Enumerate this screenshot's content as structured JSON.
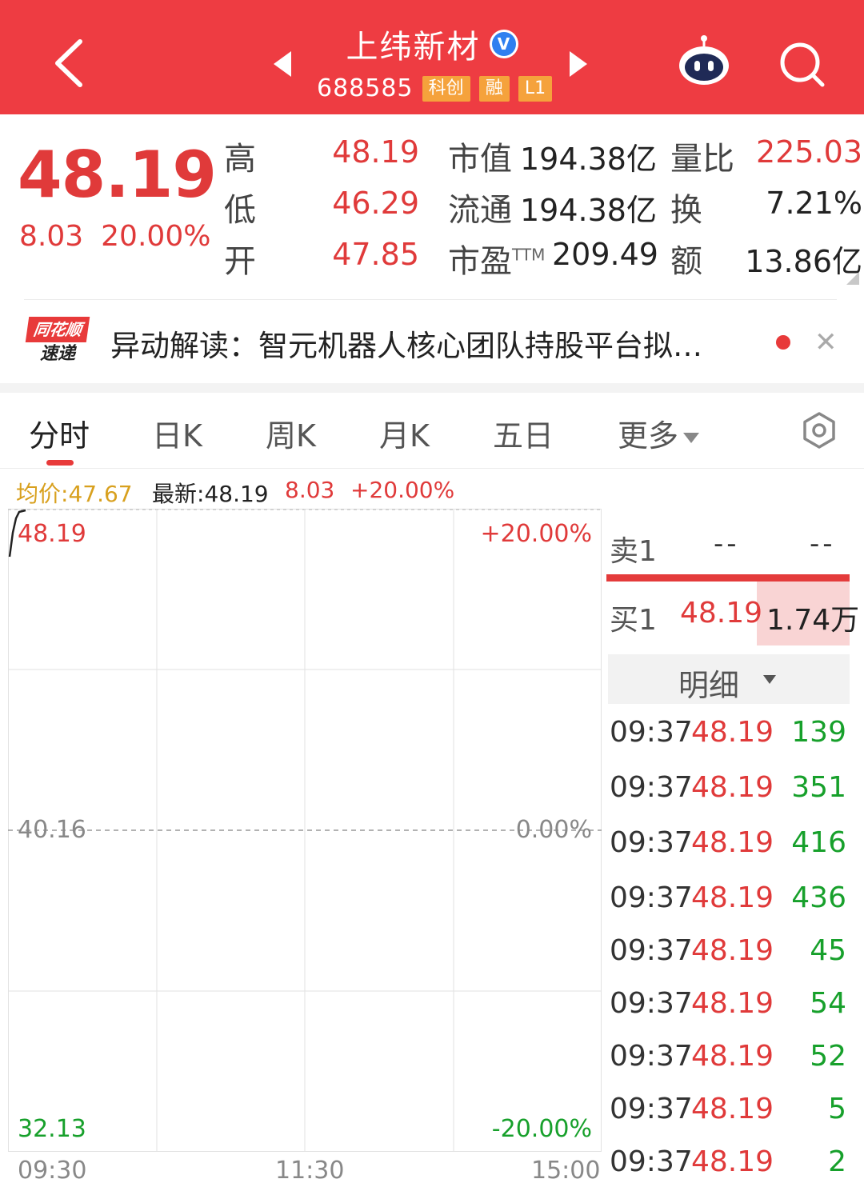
{
  "header": {
    "stock_name": "上纬新材",
    "verified_badge": "V",
    "code": "688585",
    "tags": [
      "科创",
      "融",
      "L1"
    ],
    "colors": {
      "bar": "#ee3c42",
      "tag": "#f5a23c"
    },
    "icons": [
      "back-arrow-icon",
      "prev-stock-icon",
      "next-stock-icon",
      "robot-assistant-icon",
      "search-icon"
    ]
  },
  "quote": {
    "price": "48.19",
    "change": "8.03",
    "change_pct": "20.00%",
    "high_label": "高",
    "high": "48.19",
    "low_label": "低",
    "low": "46.29",
    "open_label": "开",
    "open": "47.85",
    "mcap_label": "市值",
    "mcap": "194.38亿",
    "float_label": "流通",
    "float_mcap": "194.38亿",
    "pe_label": "市盈",
    "pe_sup": "TTM",
    "pe": "209.49",
    "vol_ratio_label": "量比",
    "vol_ratio": "225.03",
    "turnover_label": "换",
    "turnover": "7.21%",
    "amount_label": "额",
    "amount": "13.86亿"
  },
  "news": {
    "logo_top": "同花顺",
    "logo_bottom": "速递",
    "text": "异动解读：智元机器人核心团队持股平台拟…"
  },
  "tabs": {
    "items": [
      "分时",
      "日K",
      "周K",
      "月K",
      "五日",
      "更多"
    ],
    "active": "分时"
  },
  "info": {
    "avg_label": "均价:",
    "avg": "47.67",
    "latest_label": "最新:",
    "latest": "48.19",
    "change": "8.03",
    "change_pct": "+20.00%"
  },
  "chart": {
    "y_top": "48.19",
    "y_mid": "40.16",
    "y_bot": "32.13",
    "pct_top": "+20.00%",
    "pct_mid": "0.00%",
    "pct_bot": "-20.00%",
    "x_labels": [
      "09:30",
      "11:30",
      "15:00"
    ]
  },
  "order_book": {
    "sell1_label": "卖1",
    "sell1_price": "--",
    "sell1_vol": "--",
    "buy1_label": "买1",
    "buy1_price": "48.19",
    "buy1_vol": "1.74万"
  },
  "details": {
    "header": "明细",
    "rows": [
      {
        "time": "09:37",
        "price": "48.19",
        "vol": "139"
      },
      {
        "time": "09:37",
        "price": "48.19",
        "vol": "351"
      },
      {
        "time": "09:37",
        "price": "48.19",
        "vol": "416"
      },
      {
        "time": "09:37",
        "price": "48.19",
        "vol": "436"
      },
      {
        "time": "09:37",
        "price": "48.19",
        "vol": "45"
      },
      {
        "time": "09:37",
        "price": "48.19",
        "vol": "54"
      },
      {
        "time": "09:37",
        "price": "48.19",
        "vol": "52"
      },
      {
        "time": "09:37",
        "price": "48.19",
        "vol": "5"
      },
      {
        "time": "09:37",
        "price": "48.19",
        "vol": "2"
      }
    ]
  }
}
